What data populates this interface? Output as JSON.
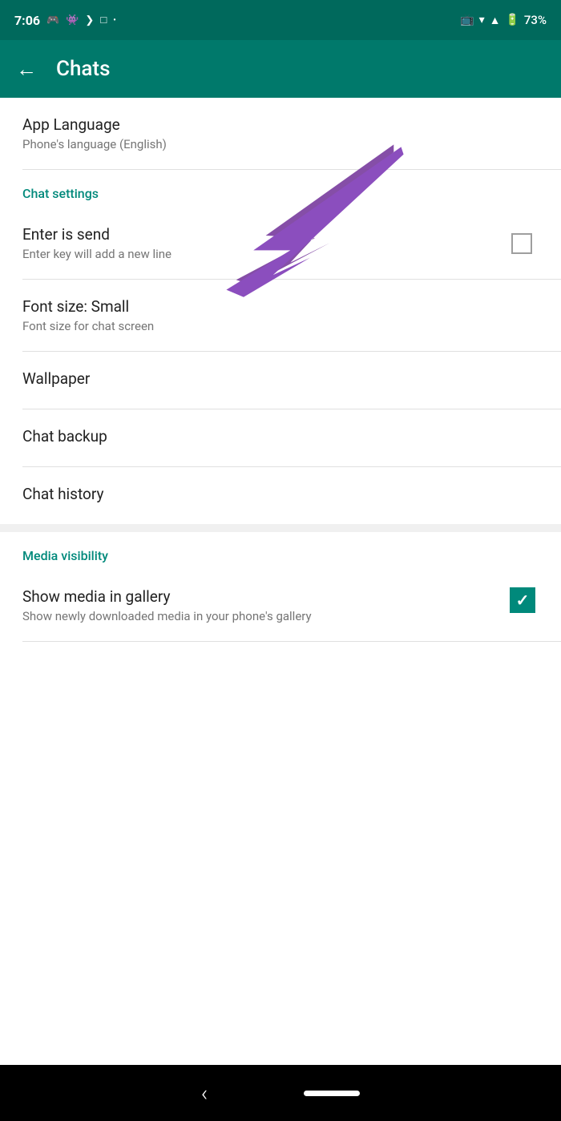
{
  "statusBar": {
    "time": "7:06",
    "battery": "73%",
    "icons": [
      "cast",
      "wifi",
      "signal",
      "battery"
    ]
  },
  "header": {
    "backLabel": "←",
    "title": "Chats"
  },
  "appLanguage": {
    "title": "App Language",
    "subtitle": "Phone's language (English)"
  },
  "chatSettings": {
    "sectionLabel": "Chat settings",
    "enterIsSend": {
      "title": "Enter is send",
      "subtitle": "Enter key will add a new line",
      "checked": false
    },
    "fontSize": {
      "title": "Font size: Small",
      "subtitle": "Font size for chat screen"
    },
    "wallpaper": {
      "title": "Wallpaper"
    },
    "chatBackup": {
      "title": "Chat backup"
    },
    "chatHistory": {
      "title": "Chat history"
    }
  },
  "mediaVisibility": {
    "sectionLabel": "Media visibility",
    "showMedia": {
      "title": "Show media in gallery",
      "subtitle": "Show newly downloaded media in your phone's gallery",
      "checked": true
    }
  },
  "navBar": {
    "back": "‹"
  },
  "colors": {
    "headerBg": "#00796b",
    "statusBg": "#00695c",
    "teal": "#00897b"
  }
}
